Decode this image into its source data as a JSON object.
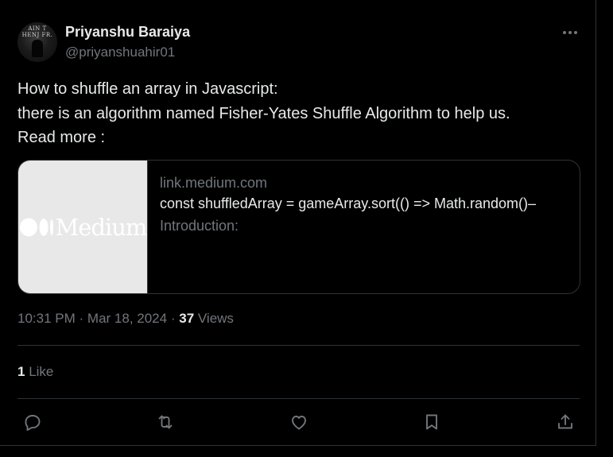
{
  "author": {
    "display_name": "Priyanshu Baraiya",
    "handle": "@priyanshuahir01",
    "avatar_text": "AIN T\nHENJ FR."
  },
  "menu": {
    "more_icon": "more-horizontal-icon"
  },
  "tweet": {
    "lines": [
      "How to shuffle an array in Javascript:",
      "there is an algorithm named Fisher-Yates Shuffle Algorithm to help us.",
      "Read more :"
    ]
  },
  "link_card": {
    "domain": "link.medium.com",
    "title": "const shuffledArray = gameArray.sort(() => Math.random()–",
    "description": "Introduction:",
    "thumbnail_wordmark": "Medium",
    "thumbnail_bg": "#e8e8e8"
  },
  "meta": {
    "time": "10:31 PM",
    "separator": "·",
    "date": "Mar 18, 2024",
    "views_count": "37",
    "views_label": "Views"
  },
  "engagement": {
    "likes_count": "1",
    "likes_label": "Like"
  },
  "actions": [
    {
      "name": "reply",
      "icon": "reply-icon"
    },
    {
      "name": "retweet",
      "icon": "retweet-icon"
    },
    {
      "name": "like",
      "icon": "heart-icon"
    },
    {
      "name": "bookmark",
      "icon": "bookmark-icon"
    },
    {
      "name": "share",
      "icon": "share-icon"
    }
  ],
  "colors": {
    "background": "#000000",
    "text_primary": "#e7e9ea",
    "text_secondary": "#71767b",
    "border": "#2f3336"
  }
}
